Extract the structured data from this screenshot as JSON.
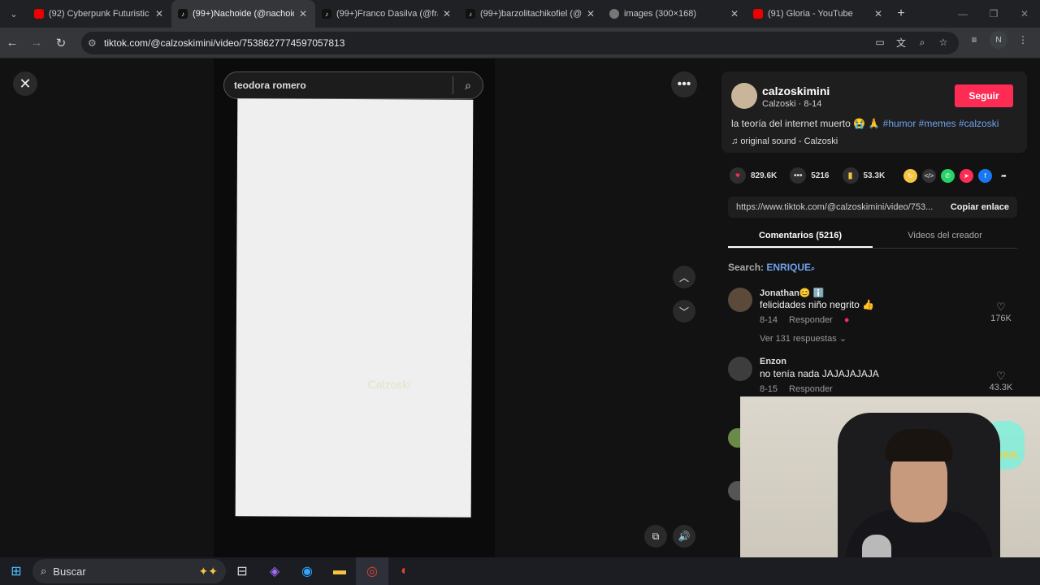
{
  "browser": {
    "tabs": [
      {
        "label": "(92) Cyberpunk Futuristic D",
        "icon": "youtube-icon",
        "active": false
      },
      {
        "label": "(99+)Nachoide (@nachoide",
        "icon": "tiktok-icon",
        "active": true
      },
      {
        "label": "(99+)Franco Dasilva (@fra",
        "icon": "tiktok-icon",
        "active": false
      },
      {
        "label": "(99+)barzolitachikofiel (@b",
        "icon": "tiktok-icon",
        "active": false
      },
      {
        "label": "images (300×168)",
        "icon": "image-icon",
        "active": false
      },
      {
        "label": "(91) Gloria - YouTube",
        "icon": "youtube-icon",
        "active": false
      }
    ],
    "url": "tiktok.com/@calzoskimini/video/7538627774597057813",
    "profile_initial": "N"
  },
  "video": {
    "search_value": "teodora romero",
    "watermark": "Calzoski"
  },
  "panel": {
    "username": "calzoskimini",
    "display_name_date": "Calzoski · 8-14",
    "follow_label": "Seguir",
    "description": "la teoría del internet muerto 😭 🙏 ",
    "hashtags": "#humor #memes #calzoski",
    "sound": "original sound - Calzoski",
    "likes": "829.6K",
    "comments_count": "5216",
    "saves": "53.3K",
    "share_link": "https://www.tiktok.com/@calzoskimini/video/753...",
    "copy_link_label": "Copiar enlace",
    "tab_comments": "Comentarios (5216)",
    "tab_creator": "Videos del creador",
    "search_label": "Search: ",
    "search_query": "ENRIQUE"
  },
  "comments": [
    {
      "name": "Jonathan😊 ℹ️",
      "text": "felicidades niño negrito 👍",
      "date": "8-14",
      "reply": "Responder",
      "likes": "176K",
      "replies": "Ver 131 respuestas ⌄"
    },
    {
      "name": "Enzon",
      "text": "no tenía nada JAJAJAJAJA",
      "date": "8-15",
      "reply": "Responder",
      "likes": "43.3K",
      "replies": ""
    }
  ],
  "webcam": {
    "lamp_text": "JOHDAN"
  },
  "taskbar": {
    "search_label": "Buscar"
  }
}
